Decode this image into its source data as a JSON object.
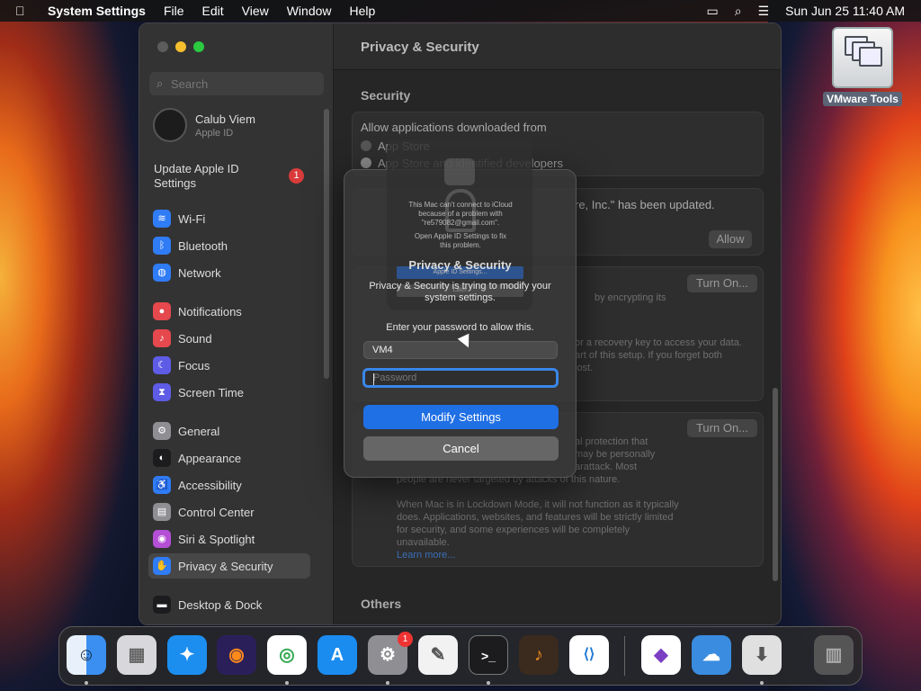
{
  "menubar": {
    "app": "System Settings",
    "items": [
      "File",
      "Edit",
      "View",
      "Window",
      "Help"
    ],
    "datetime": "Sun Jun 25  11:40 AM"
  },
  "desktop": {
    "vmware_label": "VMware Tools"
  },
  "window": {
    "title": "Privacy & Security",
    "search_placeholder": "Search",
    "profile": {
      "name": "Calub Viem",
      "sub": "Apple ID"
    },
    "update": {
      "label": "Update Apple ID Settings",
      "badge": "1"
    },
    "sidebar": [
      {
        "label": "Wi-Fi",
        "color": "#2f7cf6"
      },
      {
        "label": "Bluetooth",
        "color": "#2f7cf6"
      },
      {
        "label": "Network",
        "color": "#2f7cf6"
      },
      {
        "label": "Notifications",
        "color": "#e5484d"
      },
      {
        "label": "Sound",
        "color": "#e5484d"
      },
      {
        "label": "Focus",
        "color": "#5e5ce6"
      },
      {
        "label": "Screen Time",
        "color": "#5e5ce6"
      },
      {
        "label": "General",
        "color": "#8e8e93"
      },
      {
        "label": "Appearance",
        "color": "#1c1c1e"
      },
      {
        "label": "Accessibility",
        "color": "#2f7cf6"
      },
      {
        "label": "Control Center",
        "color": "#8e8e93"
      },
      {
        "label": "Siri & Spotlight",
        "color": "#b44fd6"
      },
      {
        "label": "Privacy & Security",
        "color": "#2f7cf6"
      },
      {
        "label": "Desktop & Dock",
        "color": "#1c1c1e"
      }
    ],
    "content": {
      "security_heading": "Security",
      "allow_from": "Allow applications downloaded from",
      "opt_app_store": "App Store",
      "opt_identified": "App Store and identified developers",
      "updated_msg": "re, Inc.\" has been updated.",
      "allow_btn": "Allow",
      "turn_on_1": "Turn On...",
      "encrypt_text": "by encrypting its",
      "recovery_text_1": "or a recovery key to access your data.",
      "recovery_text_2": "art of this setup. If you forget both",
      "recovery_text_3": "lost.",
      "turn_on_2": "Turn On...",
      "lockdown_1": "al protection that",
      "lockdown_2": "may be personally",
      "lockdown_3": "arattack. Most",
      "lockdown_4": "people are never targeted by attacks of this nature.",
      "lockdown_p2": "When Mac is in Lockdown Mode, it will not function as it typically does. Applications, websites, and features will be strictly limited for security, and some experiences will be completely unavailable.",
      "learn_more": "Learn more...",
      "others_heading": "Others"
    }
  },
  "dialog": {
    "bg_message": "This Mac can't connect to iCloud because of a problem with \"re579082@gmail.com\".",
    "bg_hint": "Open Apple ID Settings to fix this problem.",
    "bg_btn1": "Apple ID Settings...",
    "bg_btn2": "Later",
    "title": "Privacy & Security",
    "message": "Privacy & Security is trying to modify your system settings.",
    "ask": "Enter your password to allow this.",
    "username": "VM4",
    "password_placeholder": "Password",
    "primary": "Modify Settings",
    "cancel": "Cancel"
  },
  "dock": {
    "apps": [
      {
        "name": "Finder",
        "glyph": "☺",
        "color": "#3b8ff0"
      },
      {
        "name": "Launchpad",
        "glyph": "▦",
        "color": "#d8d8dc"
      },
      {
        "name": "Safari",
        "glyph": "✦",
        "color": "#1c8ef0"
      },
      {
        "name": "Firefox",
        "glyph": "◉",
        "color": "#e86a1a"
      },
      {
        "name": "Chrome",
        "glyph": "◎",
        "color": "#34a853"
      },
      {
        "name": "App Store",
        "glyph": "A",
        "color": "#1a8cf0"
      },
      {
        "name": "System Settings",
        "glyph": "⚙",
        "color": "#8e8e93"
      },
      {
        "name": "TextEdit",
        "glyph": "✎",
        "color": "#f2f2f2"
      },
      {
        "name": "Terminal",
        "glyph": ">_",
        "color": "#1c1c1e"
      },
      {
        "name": "GarageBand",
        "glyph": "♪",
        "color": "#d86b1f"
      },
      {
        "name": "VS Code",
        "glyph": "⟨⟩",
        "color": "#ffffff"
      },
      {
        "name": "Visual Studio",
        "glyph": "◆",
        "color": "#ffffff"
      },
      {
        "name": "Weather",
        "glyph": "☁",
        "color": "#3a8ce0"
      },
      {
        "name": "Installer",
        "glyph": "⬇",
        "color": "#e0e0e0"
      },
      {
        "name": "Trash",
        "glyph": "🗑",
        "color": "#555555"
      }
    ],
    "settings_badge": "1"
  }
}
